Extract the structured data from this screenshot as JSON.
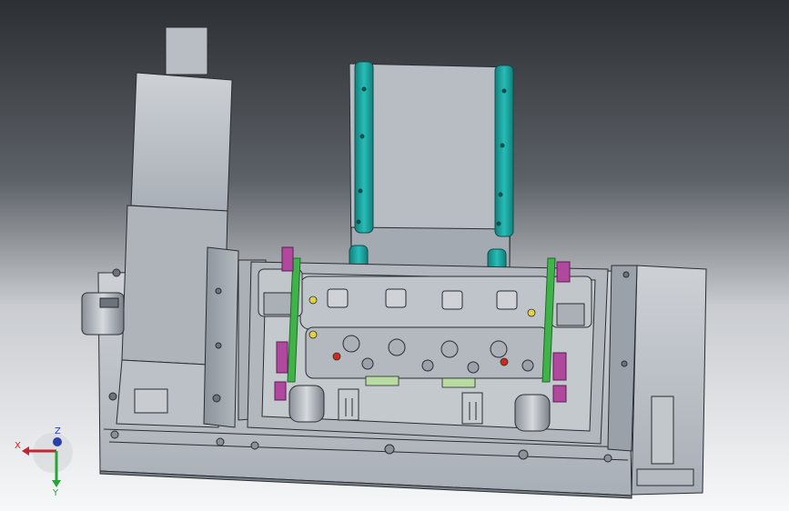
{
  "viewport": {
    "description_colors": {
      "background_top": "#2e3134",
      "background_bottom": "#f4f5f6",
      "metal_light": "#c4c9cf",
      "metal_mid": "#9aa1a9",
      "metal_dark": "#6c737b",
      "edge": "#2a2d31",
      "teal_rail": "#1fa7a3",
      "green_bar": "#3fb24a",
      "magenta_block": "#b0489e",
      "yellow_mark": "#e3d343",
      "red_mark": "#d02a1a",
      "pale_green_pad": "#b7dba0"
    }
  },
  "triad": {
    "x_label": "X",
    "y_label": "Y",
    "z_label": "Z",
    "x_color": "#c0262d",
    "y_color": "#2aa337",
    "z_color": "#2c3ea8"
  }
}
